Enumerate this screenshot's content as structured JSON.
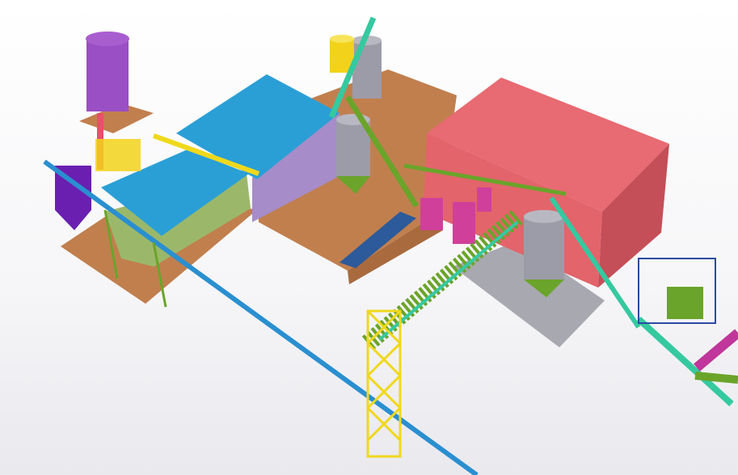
{
  "viewer": {
    "view": "3d-model-perspective",
    "colors": {
      "ground": "#c17f4e",
      "ground_dark": "#a96a3e",
      "warehouse_top": "#e86a72",
      "warehouse_front": "#e3646b",
      "warehouse_side": "#c44f58",
      "slab_gray": "#a8a8b0",
      "roof_blue": "#2a9fd6",
      "wall_purple": "#a68cc8",
      "silo_gray": "#9c9ca8",
      "silo_purple": "#9b4fc4",
      "silo_yellow": "#f2d21a",
      "truss_green": "#6aa42a",
      "truss_cyan": "#35c9a0",
      "truss_yellow": "#f0d81c",
      "conveyor_blue": "#2a8fd0",
      "pipe_magenta": "#c0369a",
      "machine_magenta": "#d0409a",
      "strip_navy": "#2d5a9a"
    }
  }
}
